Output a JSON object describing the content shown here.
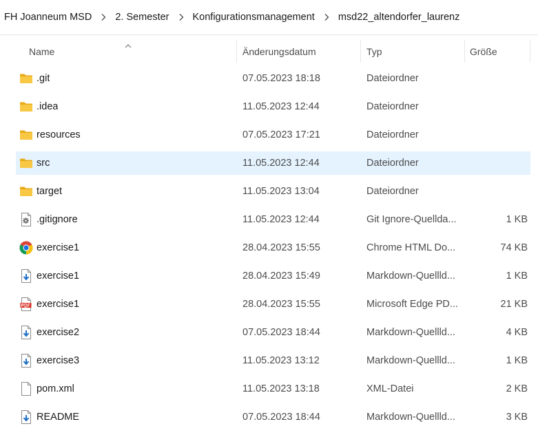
{
  "breadcrumb": [
    "FH Joanneum MSD",
    "2. Semester",
    "Konfigurationsmanagement",
    "msd22_altendorfer_laurenz"
  ],
  "columns": {
    "name": "Name",
    "date": "Änderungsdatum",
    "type": "Typ",
    "size": "Größe"
  },
  "files": [
    {
      "icon": "folder-icon",
      "name": ".git",
      "date": "07.05.2023 18:18",
      "type": "Dateiordner",
      "size": ""
    },
    {
      "icon": "folder-icon",
      "name": ".idea",
      "date": "11.05.2023 12:44",
      "type": "Dateiordner",
      "size": ""
    },
    {
      "icon": "folder-icon",
      "name": "resources",
      "date": "07.05.2023 17:21",
      "type": "Dateiordner",
      "size": ""
    },
    {
      "icon": "folder-icon",
      "name": "src",
      "date": "11.05.2023 12:44",
      "type": "Dateiordner",
      "size": "",
      "selected": true
    },
    {
      "icon": "folder-icon",
      "name": "target",
      "date": "11.05.2023 13:04",
      "type": "Dateiordner",
      "size": ""
    },
    {
      "icon": "settings-file-icon",
      "name": ".gitignore",
      "date": "11.05.2023 12:44",
      "type": "Git Ignore-Quellda...",
      "size": "1 KB"
    },
    {
      "icon": "chrome-icon",
      "name": "exercise1",
      "date": "28.04.2023 15:55",
      "type": "Chrome HTML Do...",
      "size": "74 KB"
    },
    {
      "icon": "markdown-file-icon",
      "name": "exercise1",
      "date": "28.04.2023 15:49",
      "type": "Markdown-Quellld...",
      "size": "1 KB"
    },
    {
      "icon": "pdf-icon",
      "name": "exercise1",
      "date": "28.04.2023 15:55",
      "type": "Microsoft Edge PD...",
      "size": "21 KB"
    },
    {
      "icon": "markdown-file-icon",
      "name": "exercise2",
      "date": "07.05.2023 18:44",
      "type": "Markdown-Quellld...",
      "size": "4 KB"
    },
    {
      "icon": "markdown-file-icon",
      "name": "exercise3",
      "date": "11.05.2023 13:12",
      "type": "Markdown-Quellld...",
      "size": "1 KB"
    },
    {
      "icon": "blank-file-icon",
      "name": "pom.xml",
      "date": "11.05.2023 13:18",
      "type": "XML-Datei",
      "size": "2 KB"
    },
    {
      "icon": "markdown-file-icon",
      "name": "README",
      "date": "07.05.2023 18:44",
      "type": "Markdown-Quellld...",
      "size": "3 KB"
    }
  ],
  "colors": {
    "selected_row": "#e5f3ff",
    "folder": "#f8c744",
    "accent": "#1f6fc5"
  }
}
